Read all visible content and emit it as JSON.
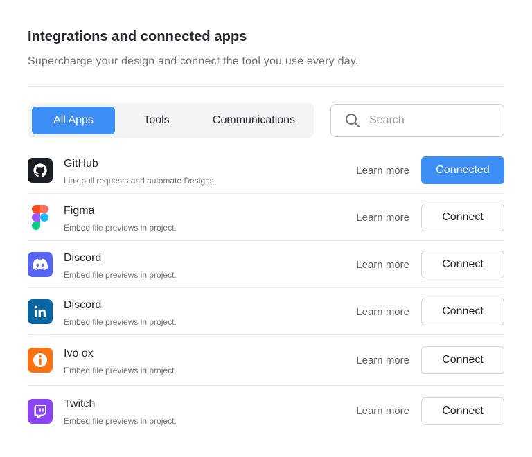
{
  "header": {
    "title": "Integrations and connected apps",
    "subtitle": "Supercharge your design and connect the tool you use every day."
  },
  "tabs": [
    {
      "label": "All Apps",
      "active": true
    },
    {
      "label": "Tools",
      "active": false
    },
    {
      "label": "Communications",
      "active": false
    }
  ],
  "search": {
    "placeholder": "Search",
    "value": ""
  },
  "apps": [
    {
      "name": "GitHub",
      "description": "Link pull requests and automate Designs.",
      "learn_more": "Learn more",
      "button": "Connected",
      "icon": "github-icon",
      "color": "#1b1f23"
    },
    {
      "name": "Figma",
      "description": "Embed file previews in project.",
      "learn_more": "Learn more",
      "button": "Connect",
      "icon": "figma-icon",
      "color": "#f24e1e"
    },
    {
      "name": "Discord",
      "description": "Embed file previews in project.",
      "learn_more": "Learn more",
      "button": "Connect",
      "icon": "discord-icon",
      "color": "#5865f2"
    },
    {
      "name": "Discord",
      "description": "Embed file previews in project.",
      "learn_more": "Learn more",
      "button": "Connect",
      "icon": "linkedin-icon",
      "color": "#0a66a2"
    },
    {
      "name": "Ivo ox",
      "description": "Embed file previews in project.",
      "learn_more": "Learn more",
      "button": "Connect",
      "icon": "ivo-ox-icon",
      "color": "#f97316"
    },
    {
      "name": "Twitch",
      "description": "Embed file previews in project.",
      "learn_more": "Learn more",
      "button": "Connect",
      "icon": "twitch-icon",
      "color": "#8b45f7"
    }
  ],
  "colors": {
    "accent": "#3d8ff6",
    "text_primary": "#24282e",
    "text_secondary": "#6b7079",
    "tab_bg": "#f3f4f6"
  }
}
